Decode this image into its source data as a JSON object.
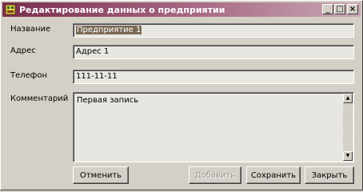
{
  "window": {
    "title": "Редактирование данных о предприятии",
    "controls": {
      "minimize": "_",
      "maximize": "□",
      "close": "×"
    }
  },
  "form": {
    "name_label": "Название",
    "name_value": "Предприятие 1",
    "address_label": "Адрес",
    "address_value": "Адрес 1",
    "phone_label": "Телефон",
    "phone_value": "111-11-11",
    "comment_label": "Комментарий",
    "comment_value": "Первая запись"
  },
  "scrollbar": {
    "up": "▲",
    "down": "▼"
  },
  "buttons": {
    "cancel": "Отменить",
    "add": "Добавить",
    "save": "Сохранить",
    "close": "Закрыть"
  },
  "icons": {
    "app": "app-icon"
  }
}
